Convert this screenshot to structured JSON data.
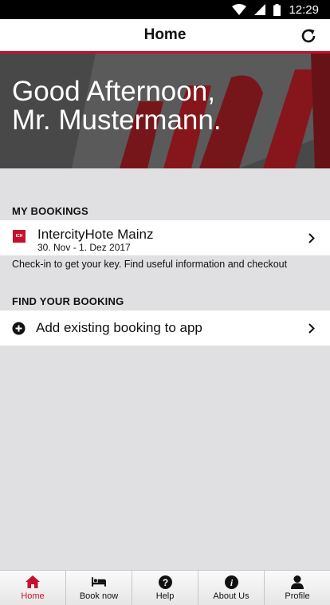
{
  "status_bar": {
    "time": "12:29",
    "icons": [
      "wifi-icon",
      "signal-icon",
      "battery-icon"
    ]
  },
  "app_bar": {
    "title": "Home",
    "refresh_icon": "refresh-icon"
  },
  "hero": {
    "greeting_line1": "Good Afternoon,",
    "greeting_line2": "Mr. Mustermann."
  },
  "my_bookings": {
    "header": "MY BOOKINGS",
    "booking": {
      "logo_text": "ICH",
      "hotel_name": "IntercityHote Mainz",
      "dates": "30. Nov - 1. Dez 2017"
    },
    "hint": "Check-in to get your key. Find useful information and checkout"
  },
  "find_booking": {
    "header": "FIND YOUR BOOKING",
    "add_label": "Add existing booking to app"
  },
  "tab_bar": {
    "tabs": [
      {
        "label": "Home",
        "icon": "home-icon",
        "active": true
      },
      {
        "label": "Book now",
        "icon": "bed-icon",
        "active": false
      },
      {
        "label": "Help",
        "icon": "help-icon",
        "active": false
      },
      {
        "label": "About Us",
        "icon": "info-icon",
        "active": false
      },
      {
        "label": "Profile",
        "icon": "person-icon",
        "active": false
      }
    ]
  },
  "colors": {
    "accent": "#c8102e",
    "background": "#e0e0e2",
    "status_bar": "#000000"
  }
}
